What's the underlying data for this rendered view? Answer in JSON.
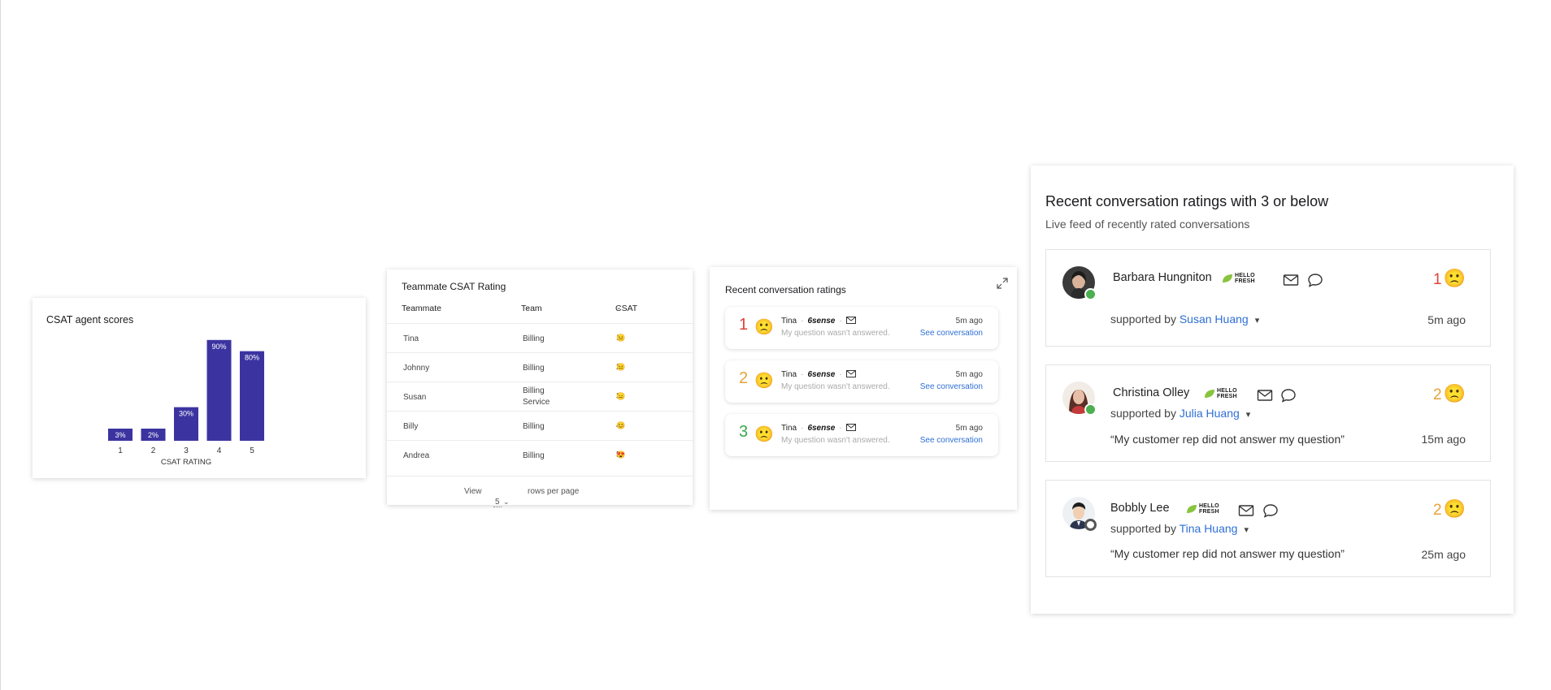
{
  "chart_card": {
    "title": "CSAT agent scores",
    "bar_color": "#3b34a0"
  },
  "chart_data": {
    "type": "bar",
    "title": "CSAT agent scores",
    "xlabel": "CSAT RATING",
    "ylabel": "",
    "categories": [
      "1",
      "2",
      "3",
      "4",
      "5"
    ],
    "values": [
      3,
      2,
      30,
      90,
      80
    ],
    "value_labels": [
      "3%",
      "2%",
      "30%",
      "90%",
      "80%"
    ],
    "ylim": [
      0,
      100
    ],
    "grid": false
  },
  "table_card": {
    "title": "Teammate CSAT Rating",
    "columns": [
      "Teammate",
      "Team",
      "CSAT"
    ],
    "rows": [
      {
        "teammate": "Tina",
        "team": "Billing",
        "team2": "",
        "csat": "1",
        "emoji": "😐"
      },
      {
        "teammate": "Johnny",
        "team": "Billing",
        "team2": "",
        "csat": "2",
        "emoji": "😐"
      },
      {
        "teammate": "Susan",
        "team": "Billing",
        "team2": "Service",
        "csat": "3",
        "emoji": "😑"
      },
      {
        "teammate": "Billy",
        "team": "Billing",
        "team2": "",
        "csat": "4",
        "emoji": "😊"
      },
      {
        "teammate": "Andrea",
        "team": "Billing",
        "team2": "",
        "csat": "5",
        "emoji": "😍"
      }
    ],
    "footer": {
      "view_label": "View",
      "rows_value": "5",
      "rows_label": "rows per page"
    }
  },
  "recent_card": {
    "title": "Recent conversation ratings",
    "items": [
      {
        "rating": "1",
        "rating_color": "#e0433a",
        "emoji": "🙁",
        "name": "Tina",
        "brand": "6sense",
        "question": "My question wasn't answered.",
        "time": "5m ago",
        "link": "See conversation"
      },
      {
        "rating": "2",
        "rating_color": "#e8a23a",
        "emoji": "🙁",
        "name": "Tina",
        "brand": "6sense",
        "question": "My question wasn't answered.",
        "time": "5m ago",
        "link": "See conversation"
      },
      {
        "rating": "3",
        "rating_color": "#3aa84a",
        "emoji": "🙁",
        "name": "Tina",
        "brand": "6sense",
        "question": "My question wasn't answered.",
        "time": "5m ago",
        "link": "See conversation"
      }
    ]
  },
  "big_card": {
    "title": "Recent conversation ratings with 3 or below",
    "subtitle": "Live feed of recently rated conversations",
    "brand_line1": "HELLO",
    "brand_line2": "FRESH",
    "supported_prefix": "supported by",
    "items": [
      {
        "name": "Barbara Hungniton",
        "agent": "Susan Huang",
        "rating": "1",
        "rating_color": "#e0433a",
        "emoji": "🙁",
        "quote": "",
        "time": "5m ago",
        "status_color": "#4caf50",
        "avatar_bg": "#3a3a3a",
        "avatar_skin": "#d9b49a"
      },
      {
        "name": "Christina Olley",
        "agent": "Julia Huang",
        "rating": "2",
        "rating_color": "#e8a23a",
        "emoji": "🙁",
        "quote": "“My customer rep did not answer my question”",
        "time": "15m ago",
        "status_color": "#4caf50",
        "avatar_bg": "#5a2f26",
        "avatar_skin": "#e7bfa8"
      },
      {
        "name": "Bobbly Lee",
        "agent": "Tina Huang",
        "rating": "2",
        "rating_color": "#e8a23a",
        "emoji": "🙁",
        "quote": "“My customer rep did not answer my question”",
        "time": "25m ago",
        "status_color": "#555555",
        "avatar_bg": "#1f1f1f",
        "avatar_skin": "#f0cfb3"
      }
    ]
  }
}
